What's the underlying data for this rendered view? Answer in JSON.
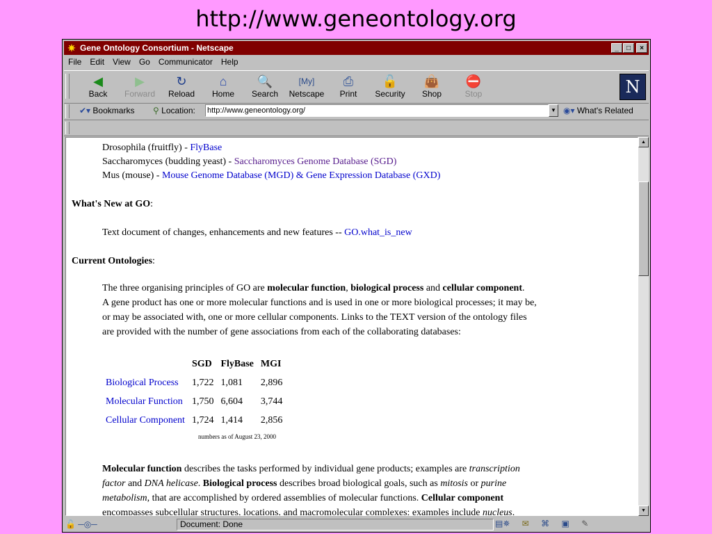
{
  "slide_title": "http://www.geneontology.org",
  "window": {
    "title": "Gene Ontology Consortium - Netscape",
    "controls": [
      "_",
      "□",
      "×"
    ]
  },
  "menu": [
    "File",
    "Edit",
    "View",
    "Go",
    "Communicator",
    "Help"
  ],
  "toolbar": [
    {
      "label": "Back",
      "icon": "back-arrow-icon",
      "enabled": true
    },
    {
      "label": "Forward",
      "icon": "forward-arrow-icon",
      "enabled": false
    },
    {
      "label": "Reload",
      "icon": "reload-icon",
      "enabled": true
    },
    {
      "label": "Home",
      "icon": "home-icon",
      "enabled": true
    },
    {
      "label": "Search",
      "icon": "search-icon",
      "enabled": true
    },
    {
      "label": "Netscape",
      "icon": "my-netscape-icon",
      "enabled": true
    },
    {
      "label": "Print",
      "icon": "printer-icon",
      "enabled": true
    },
    {
      "label": "Security",
      "icon": "lock-icon",
      "enabled": true
    },
    {
      "label": "Shop",
      "icon": "shopping-bag-icon",
      "enabled": true
    },
    {
      "label": "Stop",
      "icon": "stop-icon",
      "enabled": false
    }
  ],
  "location": {
    "bookmarks_label": "Bookmarks",
    "location_label": "Location:",
    "url": "http://www.geneontology.org/",
    "related_label": "What's Related"
  },
  "content": {
    "organisms": [
      {
        "name": "Drosophila (fruitfly) - ",
        "link": "FlyBase"
      },
      {
        "name": "Saccharomyces (budding yeast) - ",
        "link": "Saccharomyces Genome Database (SGD)"
      },
      {
        "name": "Mus (mouse) - ",
        "link": "Mouse Genome Database (MGD) & Gene Expression Database (GXD)"
      }
    ],
    "whats_new_heading": "What's New at GO",
    "whats_new_text": "Text document of changes, enhancements and new features -- ",
    "whats_new_link": "GO.what_is_new",
    "current_heading": "Current Ontologies",
    "intro_1": "The three organising principles of GO are ",
    "mf": "molecular function",
    "bp": "biological process",
    "cc": "cellular component",
    "intro_and": "and",
    "intro_rest_1": "A gene product has one or more molecular functions and is used in one or more biological processes; it may be,",
    "intro_rest_2": "or may be associated with, one or more cellular components. Links to the TEXT version of the ontology files",
    "intro_rest_3": "are provided with the number of gene associations from each of the collaborating databases:",
    "table": {
      "headers": [
        "SGD",
        "FlyBase",
        "MGI"
      ],
      "rows": [
        {
          "label": "Biological Process",
          "values": [
            "1,722",
            "1,081",
            "2,896"
          ]
        },
        {
          "label": "Molecular Function",
          "values": [
            "1,750",
            "6,604",
            "3,744"
          ]
        },
        {
          "label": "Cellular Component",
          "values": [
            "1,724",
            "1,414",
            "2,856"
          ]
        }
      ],
      "note": "numbers as of August 23, 2000"
    },
    "desc": {
      "mf_bold": "Molecular function",
      "t1": " describes the tasks performed by individual gene products; examples are ",
      "i1": "transcription",
      "i1b": "factor",
      "t2": " and ",
      "i2": "DNA helicase",
      "t3": ". ",
      "bp_bold": "Biological process",
      "t4": " describes broad biological goals, such as ",
      "i3": "mitosis",
      "t5": " or ",
      "i4": "purine",
      "i4b": "metabolism",
      "t6": ", that are accomplished by ordered assemblies of molecular functions. ",
      "cc_bold": "Cellular component",
      "t7": "encompasses subcellular structures, locations, and macromolecular complexes; examples include ",
      "i5": "nucleus",
      "t8": ","
    }
  },
  "status": {
    "text": "Document: Done"
  }
}
